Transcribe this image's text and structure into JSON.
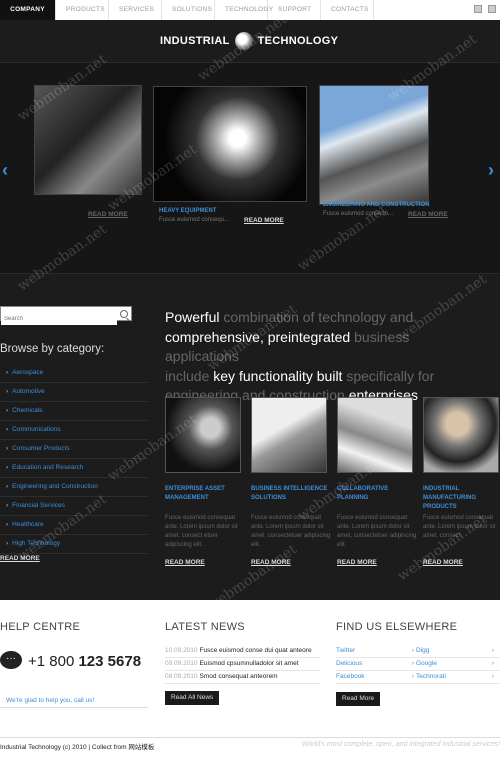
{
  "nav": {
    "items": [
      "COMPANY",
      "PRODUCTS",
      "SERVICES",
      "SOLUTIONS",
      "TECHNOLOGY",
      "SUPPORT",
      "CONTACTS"
    ]
  },
  "logo": {
    "left": "INDUSTRIAL",
    "right": "TECHNOLOGY"
  },
  "slider": {
    "slides": [
      {
        "title": "",
        "text": "",
        "readmore": "READ MORE"
      },
      {
        "title": "HEAVY EQUIPMENT",
        "text": "Fusce euismod consequ...",
        "readmore": "READ MORE"
      },
      {
        "title": "ENGINEERING AND CONSTRUCTION",
        "text": "Fusce euismod consequ...",
        "readmore": "READ MORE"
      }
    ]
  },
  "search": {
    "placeholder": "Search"
  },
  "browse": {
    "title": "Browse by category:",
    "categories": [
      "Aerospace",
      "Automotive",
      "Chemicals",
      "Communications",
      "Consumer Products",
      "Education and Research",
      "Engineering and Construction",
      "Financial Services",
      "Healthcare",
      "High Technology"
    ],
    "readmore": "READ MORE"
  },
  "headline": {
    "p1": "Powerful ",
    "p2": "combination of technology and",
    "p3": "comprehensive, preintegrated",
    "p4": " business applications",
    "p5": "include ",
    "p6": "key functionality built",
    "p7": " specifically for",
    "p8": "engineering and construction ",
    "p9": "enterprises"
  },
  "products": [
    {
      "title": "ENTERPRISE ASSET MANAGEMENT",
      "text": "Fusce euismod consequat ante. Lorem ipsum dolor sit amet, consect etuer adipiscing elit.",
      "readmore": "READ MORE"
    },
    {
      "title": "BUSINESS INTELLIGENCE SOLUTIONS",
      "text": "Fusce euismod consequat ante. Lorem ipsum dolor sit amet, consectetuer adipiscing elit.",
      "readmore": "READ MORE"
    },
    {
      "title": "COLLABORATIVE PLANNING",
      "text": "Fusce euismod consequat ante. Lorem ipsum dolor sit amet, consectetuer adipiscing elit.",
      "readmore": "READ MORE"
    },
    {
      "title": "INDUSTRIAL MANUFACTURING PRODUCTS",
      "text": "Fusce euismod consequat ante. Lorem ipsum dolor sit amet, consect.",
      "readmore": "READ MORE"
    }
  ],
  "help": {
    "title": "HELP CENTRE",
    "phone_prefix": "+1 800 ",
    "phone_main": "123 5678",
    "message": "We're glad to help you, call us!"
  },
  "news": {
    "title": "LATEST NEWS",
    "items": [
      {
        "date": "10.09.2010",
        "text": "Fusce euismod conse dui quat anteore"
      },
      {
        "date": "09.09.2010",
        "text": "Euismod cpsumnulladolor sit amet"
      },
      {
        "date": "08.09.2010",
        "text": "Smod consequat anteorem"
      }
    ],
    "button": "Read All News"
  },
  "elsewhere": {
    "title": "FIND US ELSEWHERE",
    "rows": [
      [
        "Twitter",
        "Digg"
      ],
      [
        "Delicious",
        "Google"
      ],
      [
        "Facebook",
        "Technorati"
      ]
    ],
    "button": "Read More"
  },
  "footer": {
    "left": "Industrial Technology (c) 2010  |  Collect from 网站模板",
    "right": "World's most complete, open, and integrated industrial services!"
  },
  "watermark": "webmoban.net"
}
